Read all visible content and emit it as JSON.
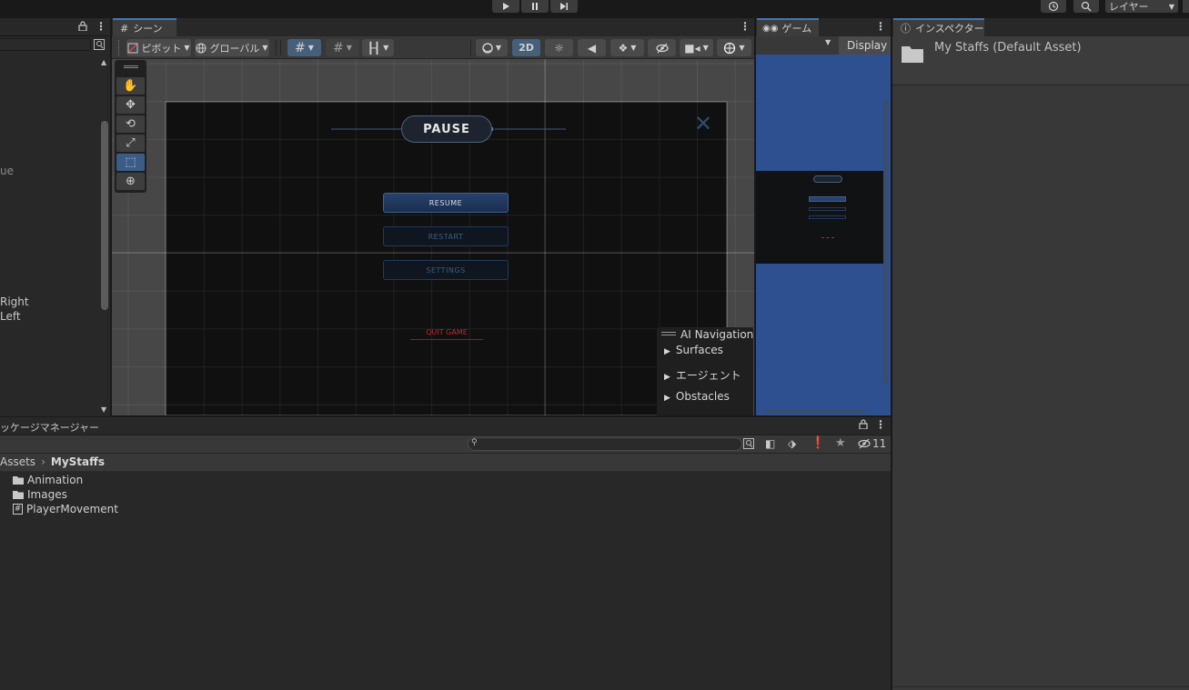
{
  "toolbar": {
    "play_icon": "play-icon",
    "pause_icon": "pause-icon",
    "step_icon": "step-icon",
    "layers_label": "レイヤー"
  },
  "hierarchy": {
    "truncated_ue": "ue",
    "right_label": "Right",
    "left_label": "Left"
  },
  "scene": {
    "tab_label": "シーン",
    "pivot_label": "ピボット",
    "global_label": "グローバル",
    "mode_2d": "2D",
    "pause_title": "PAUSE",
    "resume": "RESUME",
    "restart": "RESTART",
    "settings": "SETTINGS",
    "quit": "QUIT GAME",
    "ai_nav": {
      "title": "AI Navigation",
      "items": [
        "Surfaces",
        "エージェント",
        "Obstacles"
      ]
    }
  },
  "game": {
    "tab_label": "ゲーム",
    "display_label": "Display"
  },
  "inspector": {
    "tab_label": "インスペクター",
    "asset_title": "My Staffs (Default Asset)"
  },
  "project": {
    "tab_label": "ッケージマネージャー",
    "hidden_count": "11",
    "breadcrumb_root": "Assets",
    "breadcrumb_current": "MyStaffs",
    "items": [
      "Animation",
      "Images",
      "PlayerMovement"
    ]
  },
  "colors": {
    "accent": "#3a79bb",
    "selected_tool": "#3b5c86",
    "game_bg": "#2e5090",
    "quit_red": "#c0262c"
  }
}
